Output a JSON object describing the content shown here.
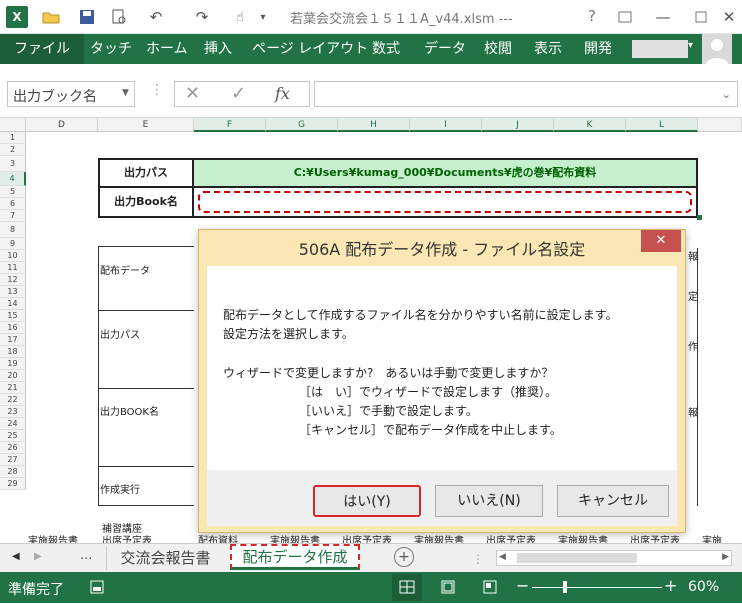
{
  "titlebar": {
    "title": "若葉会交流会１５１１A_v44.xlsm ---",
    "help": "?",
    "icons": [
      "excel-logo-icon",
      "open-folder-icon",
      "save-icon",
      "print-preview-icon",
      "undo-icon",
      "redo-icon",
      "touch-mode-icon",
      "customize-qat-icon",
      "restore-icon",
      "minimize-icon",
      "close-icon"
    ]
  },
  "ribbon": {
    "tabs": [
      "ファイル",
      "タッチ",
      "ホーム",
      "挿入",
      "ページ レイアウト",
      "数式",
      "データ",
      "校閲",
      "表示",
      "開発"
    ]
  },
  "formulabar": {
    "namebox": "出力ブック名",
    "fx": "fx"
  },
  "columns": [
    "D",
    "E",
    "F",
    "G",
    "H",
    "I",
    "J",
    "K",
    "L"
  ],
  "rows": [
    "1",
    "2",
    "3",
    "4",
    "5",
    "6",
    "7",
    "8",
    "9",
    "10",
    "11",
    "12",
    "13",
    "14",
    "15",
    "16",
    "17",
    "18",
    "19",
    "20",
    "21",
    "22",
    "23",
    "24",
    "25",
    "26",
    "27",
    "28",
    "29"
  ],
  "sheet": {
    "output_path_label": "出力パス",
    "output_path_value": "C:¥Users¥kumag_000¥Documents¥虎の巻¥配布資料",
    "output_book_label": "出力Book名",
    "section_data": "配布データ",
    "section_path": "出力パス",
    "section_book": "出力BOOK名",
    "section_run": "作成実行",
    "row28_e": "補習講座",
    "row29_d": "実施報告書",
    "row29_e": "出席予定表",
    "row29_f": "配布資料",
    "row29_g": "実施報告書",
    "row29_h": "出席予定表",
    "row29_i": "実施報告書",
    "row29_j": "出席予定表",
    "row29_k": "実施報告書",
    "row29_l": "出席予定表",
    "row29_m": "実施",
    "right_fragments": [
      "報",
      "定",
      "作",
      "報"
    ]
  },
  "dialog": {
    "title": "506A 配布データ作成 - ファイル名設定",
    "line1": "配布データとして作成するファイル名を分かりやすい名前に設定します。",
    "line2": "設定方法を選択します。",
    "line3": "ウィザードで変更しますか?　あるいは手動で変更しますか？",
    "line4": "［は　い］でウィザードで設定します（推奨）。",
    "line5": "［いいえ］で手動で設定します。",
    "line6": "［キャンセル］で配布データ作成を中止します。",
    "yes": "はい(Y)",
    "no": "いいえ(N)",
    "cancel": "キャンセル",
    "close": "✕"
  },
  "sheettabs": {
    "ellipsis": "...",
    "tab1": "交流会報告書",
    "tab2": "配布データ作成",
    "add": "+"
  },
  "status": {
    "ready": "準備完了",
    "zoom": "60%",
    "zoom_minus": "−",
    "zoom_plus": "+"
  },
  "colors": {
    "accent": "#217346",
    "path_fill": "#c6efce",
    "path_text": "#006100",
    "dialog_bg": "#fbe7b4",
    "close_red": "#c75050",
    "tab_active_text": "#217346"
  }
}
